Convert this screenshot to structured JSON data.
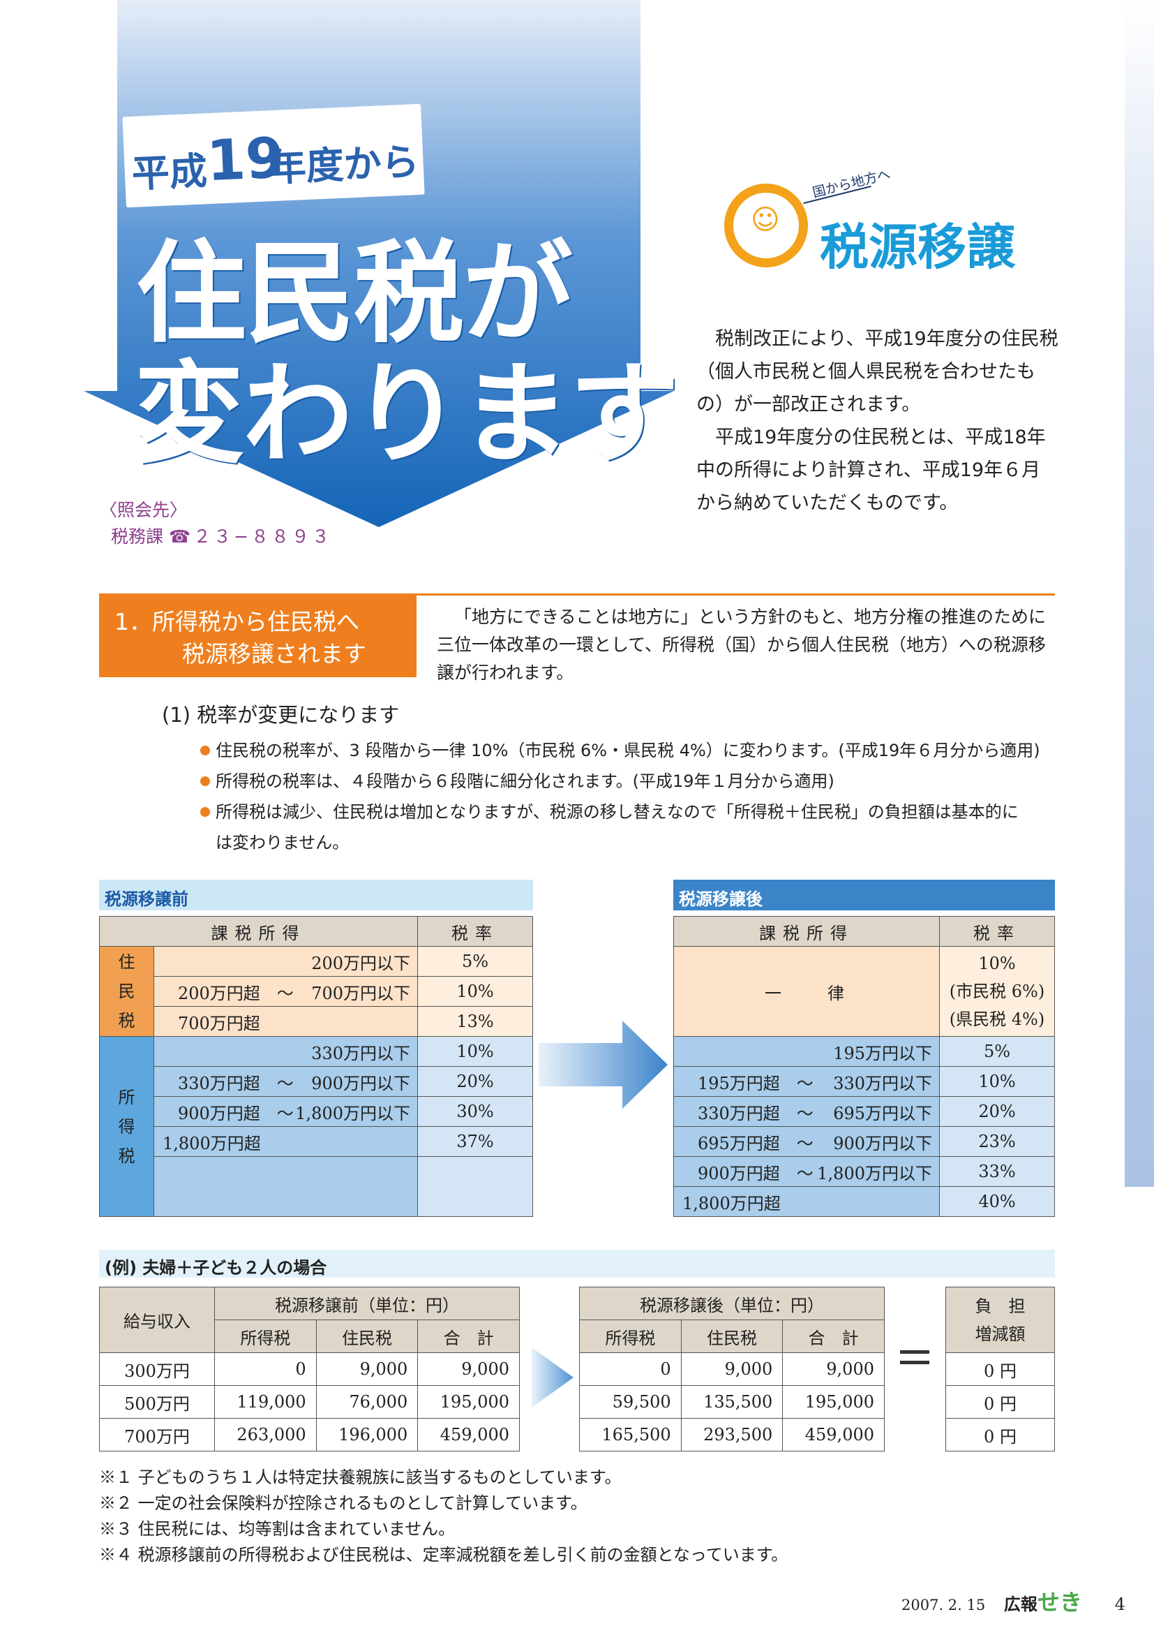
{
  "header": {
    "year_prefix": "平成",
    "year_num": "19",
    "year_suffix": "年度から",
    "title_line1": "住民税が",
    "title_line2": "変わります"
  },
  "contact": {
    "label": "〈照会先〉",
    "dept": "税務課",
    "phone": "☎２３−８８９３"
  },
  "logo": {
    "small": "国から地方へ",
    "main": "税源移譲"
  },
  "intro": [
    "税制改正により、平成19年度分の住民税（個人市民税と個人県民税を合わせたもの）が一部改正されます。",
    "平成19年度分の住民税とは、平成18年中の所得により計算され、平成19年６月から納めていただくものです。"
  ],
  "section1": {
    "title_line1": "1．所得税から住民税へ",
    "title_line2": "税源移譲されます",
    "text": "「地方にできることは地方に」という方針のもと、地方分権の推進のために三位一体改革の一環として、所得税（国）から個人住民税（地方）への税源移譲が行われます。"
  },
  "sub1": "(1) 税率が変更になります",
  "bullets": [
    "住民税の税率が、3 段階から一律 10%（市民税 6%・県民税 4%）に変わります。(平成19年６月分から適用)",
    "所得税の税率は、４段階から６段階に細分化されます。(平成19年１月分から適用)",
    "所得税は減少、住民税は増加となりますが、税源の移し替えなので「所得税＋住民税」の負担額は基本的には変わりません。"
  ],
  "before": {
    "label": "税源移譲前",
    "h_income": "課税所得",
    "h_rate": "税率",
    "resident_label": [
      "住",
      "民",
      "税"
    ],
    "income_label": [
      "所",
      "得",
      "税"
    ],
    "resident": [
      {
        "a": "",
        "b": "200万円以下",
        "rate": "5%"
      },
      {
        "a": "200万円超　～",
        "b": "700万円以下",
        "rate": "10%"
      },
      {
        "a": "700万円超",
        "b": "",
        "rate": "13%"
      }
    ],
    "income": [
      {
        "a": "",
        "b": "330万円以下",
        "rate": "10%"
      },
      {
        "a": "330万円超　～",
        "b": "900万円以下",
        "rate": "20%"
      },
      {
        "a": "900万円超　～",
        "b": "1,800万円以下",
        "rate": "30%"
      },
      {
        "a": "1,800万円超",
        "b": "",
        "rate": "37%"
      }
    ]
  },
  "after": {
    "label": "税源移譲後",
    "h_income": "課税所得",
    "h_rate": "税率",
    "flat_label": "一　　律",
    "flat_rate": [
      "10%",
      "(市民税 6%)",
      "(県民税 4%)"
    ],
    "income": [
      {
        "a": "",
        "b": "195万円以下",
        "rate": "5%"
      },
      {
        "a": "195万円超　～",
        "b": "330万円以下",
        "rate": "10%"
      },
      {
        "a": "330万円超　～",
        "b": "695万円以下",
        "rate": "20%"
      },
      {
        "a": "695万円超　～",
        "b": "900万円以下",
        "rate": "23%"
      },
      {
        "a": "900万円超　～",
        "b": "1,800万円以下",
        "rate": "33%"
      },
      {
        "a": "1,800万円超",
        "b": "",
        "rate": "40%"
      }
    ]
  },
  "example": {
    "label": "(例) 夫婦＋子ども２人の場合",
    "h_salary": "給与収入",
    "h_before": "税源移譲前（単位：円）",
    "h_after": "税源移譲後（単位：円）",
    "h_income_tax": "所得税",
    "h_resident_tax": "住民税",
    "h_total": "合　計",
    "h_diff": [
      "負　担",
      "増減額"
    ],
    "rows": [
      {
        "salary": "300万円",
        "b_it": "0",
        "b_rt": "9,000",
        "b_tot": "9,000",
        "a_it": "0",
        "a_rt": "9,000",
        "a_tot": "9,000",
        "diff": "0 円"
      },
      {
        "salary": "500万円",
        "b_it": "119,000",
        "b_rt": "76,000",
        "b_tot": "195,000",
        "a_it": "59,500",
        "a_rt": "135,500",
        "a_tot": "195,000",
        "diff": "0 円"
      },
      {
        "salary": "700万円",
        "b_it": "263,000",
        "b_rt": "196,000",
        "b_tot": "459,000",
        "a_it": "165,500",
        "a_rt": "293,500",
        "a_tot": "459,000",
        "diff": "0 円"
      }
    ]
  },
  "notes": [
    "※１ 子どものうち１人は特定扶養親族に該当するものとしています。",
    "※２ 一定の社会保険料が控除されるものとして計算しています。",
    "※３ 住民税には、均等割は含まれていません。",
    "※４ 税源移譲前の所得税および住民税は、定率減税額を差し引く前の金額となっています。"
  ],
  "footer": {
    "date": "2007. 2. 15",
    "name": "広報",
    "name_color": "せき",
    "page": "4"
  }
}
